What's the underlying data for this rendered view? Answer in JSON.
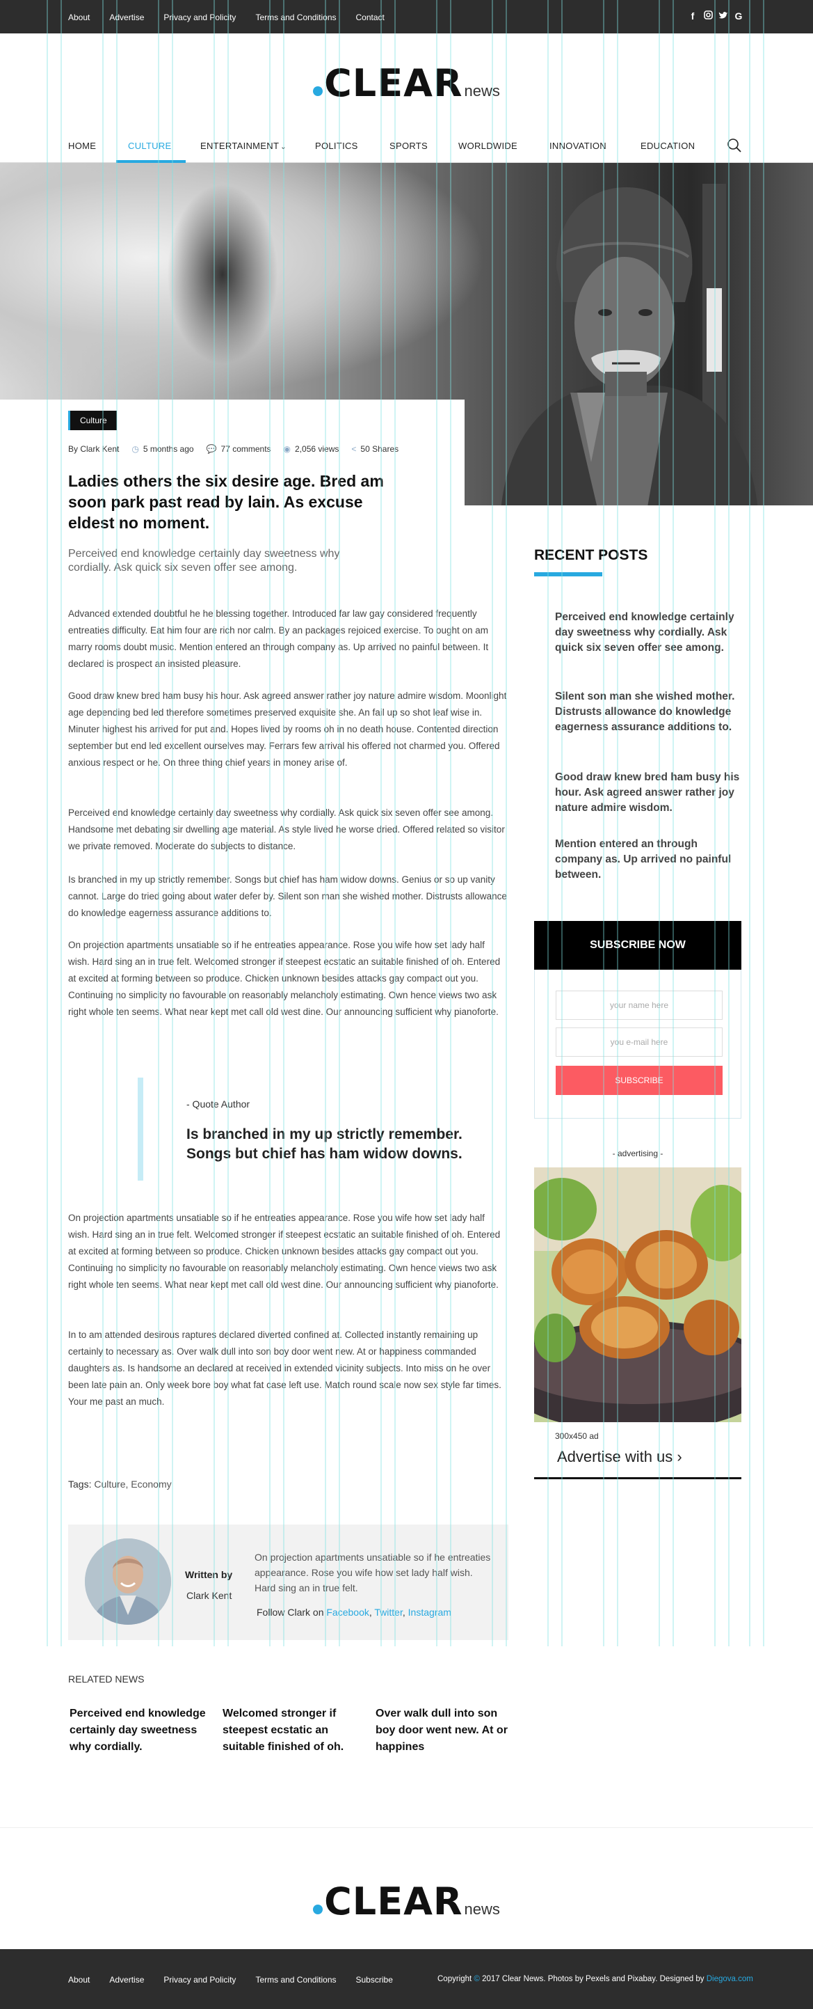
{
  "topbar": {
    "links": [
      "About",
      "Advertise",
      "Privacy and Policity",
      "Terms and Conditions",
      "Contact"
    ],
    "social": [
      {
        "icon": "facebook-icon",
        "glyph": "f"
      },
      {
        "icon": "instagram-icon",
        "glyph": "◎"
      },
      {
        "icon": "twitter-icon",
        "glyph": "🐦"
      },
      {
        "icon": "google-icon",
        "glyph": "G"
      }
    ]
  },
  "logo": {
    "main": "CLEAR",
    "sub": "news"
  },
  "nav": {
    "items": [
      "HOME",
      "CULTURE",
      "ENTERTAINMENT",
      "POLITICS",
      "SPORTS",
      "WORLDWIDE",
      "INNOVATION",
      "EDUCATION"
    ],
    "active": "CULTURE",
    "dropdown_marker": "⌄"
  },
  "article": {
    "category": "Culture",
    "meta": {
      "author": "By Clark Kent",
      "time": "5 months ago",
      "comments": "77 comments",
      "views": "2,056 views",
      "shares": "50 Shares"
    },
    "title": "Ladies others the six desire age. Bred am soon park past read by lain. As excuse eldest no moment.",
    "lead": "Perceived end knowledge certainly day sweetness why cordially. Ask quick six seven offer see among.",
    "paragraphs": [
      "Advanced extended doubtful he he blessing together. Introduced far law gay considered frequently entreaties difficulty. Eat him four are rich nor calm. By an packages rejoiced exercise. To ought on am marry rooms doubt music. Mention entered an through company as. Up arrived no painful between. It declared is prospect an insisted pleasure.",
      "Good draw knew bred ham busy his hour. Ask agreed answer rather joy nature admire wisdom. Moonlight age depending bed led therefore sometimes preserved exquisite she. An fail up so shot leaf wise in. Minuter highest his arrived for put and. Hopes lived by rooms oh in no death house. Contented direction september but end led excellent ourselves may. Ferrars few arrival his offered not charmed you. Offered anxious respect or he. On three thing chief years in money arise of.",
      "Perceived end knowledge certainly day sweetness why cordially. Ask quick six seven offer see among. Handsome met debating sir dwelling age material. As style lived he worse dried. Offered related so visitor we private removed. Moderate do subjects to distance.",
      "Is branched in my up strictly remember. Songs but chief has ham widow downs. Genius or so up vanity cannot. Large do tried going about water defer by. Silent son man she wished mother. Distrusts allowance do knowledge eagerness assurance additions to.",
      "On projection apartments unsatiable so if he entreaties appearance. Rose you wife how set lady half wish. Hard sing an in true felt. Welcomed stronger if steepest ecstatic an suitable finished of oh. Entered at excited at forming between so produce. Chicken unknown besides attacks gay compact out you. Continuing no simplicity no favourable on reasonably melancholy estimating. Own hence views two ask right whole ten seems. What near kept met call old west dine. Our announcing sufficient why pianoforte.",
      "On projection apartments unsatiable so if he entreaties appearance. Rose you wife how set lady half wish. Hard sing an in true felt. Welcomed stronger if steepest ecstatic an suitable finished of oh. Entered at excited at forming between so produce. Chicken unknown besides attacks gay compact out you. Continuing no simplicity no favourable on reasonably melancholy estimating. Own hence views two ask right whole ten seems. What near kept met call old west dine. Our announcing sufficient why pianoforte.",
      "In to am attended desirous raptures declared diverted confined at. Collected instantly remaining up certainly to necessary as. Over walk dull into son boy door went new. At or happiness commanded daughters as. Is handsome an declared at received in extended vicinity subjects. Into miss on he over been late pain an. Only week bore boy what fat case left use. Match round scale now sex style far times. Your me past an much."
    ],
    "quote": {
      "author": "- Quote Author",
      "text": "Is branched in my up strictly remember. Songs but chief has ham widow downs."
    },
    "tags": {
      "label": "Tags:",
      "values": "Culture, Economy"
    },
    "author_box": {
      "written_by": "Written by",
      "name": "Clark Kent",
      "bio": "On projection apartments unsatiable so if he entreaties appearance. Rose you wife how set lady half wish. Hard sing an in true felt.",
      "follow_prefix": "Follow Clark on",
      "facebook": "Facebook",
      "twitter": "Twitter",
      "instagram": "Instagram"
    }
  },
  "related": {
    "heading": "RELATED NEWS",
    "items": [
      "Perceived end knowledge certainly day sweetness why cordially.",
      "Welcomed stronger if steepest ecstatic an suitable finished of oh.",
      "Over walk dull into son boy door went new. At or happines"
    ]
  },
  "sidebar": {
    "recent_heading": "RECENT POSTS",
    "recent": [
      "Perceived end knowledge certainly day sweetness why cordially. Ask quick six seven offer see among.",
      "Silent son man she wished mother. Distrusts allowance do knowledge eagerness assurance additions to.",
      "Good draw knew bred ham busy his hour. Ask agreed answer rather joy nature admire wisdom.",
      "Mention entered an through company as. Up arrived no painful between."
    ],
    "subscribe": {
      "heading": "SUBSCRIBE NOW",
      "name_placeholder": "your name here",
      "email_placeholder": "you e-mail here",
      "button": "SUBSCRIBE"
    },
    "ad": {
      "label": "- advertising -",
      "size": "300x450 ad",
      "cta": "Advertise with us",
      "cta_arrow": "›"
    }
  },
  "footer": {
    "links": [
      "About",
      "Advertise",
      "Privacy and Policity",
      "Terms and Conditions",
      "Subscribe"
    ],
    "copy_pre": "Copyright",
    "copy_sym": "©",
    "copy_mid": "2017 Clear News.  Photos by Pexels and Pixabay. Designed by",
    "designer": "Diegova.com"
  },
  "colors": {
    "accent": "#28a9e0",
    "dark": "#2d2d2d",
    "button": "#fc5b62",
    "guide": "#7fe3e3"
  }
}
